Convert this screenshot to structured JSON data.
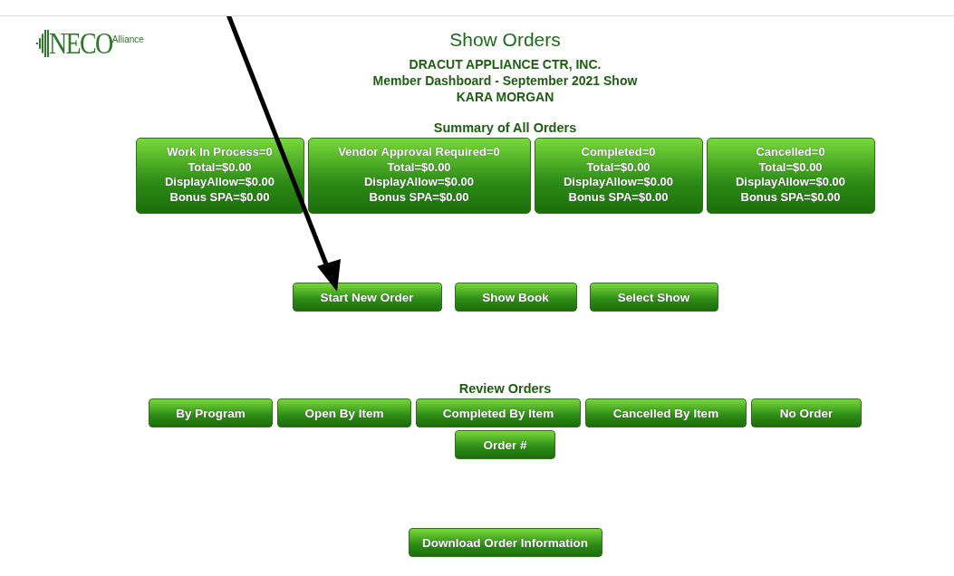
{
  "logo": {
    "wordmark": "NECO",
    "suffix": "Alliance"
  },
  "page_title": "Show Orders",
  "header_lines": [
    "DRACUT APPLIANCE CTR, INC.",
    "Member Dashboard - September 2021 Show",
    "KARA MORGAN"
  ],
  "summary": {
    "title": "Summary of All Orders",
    "cards": [
      {
        "lines": [
          "Work In Process=0",
          "Total=$0.00",
          "DisplayAllow=$0.00",
          "Bonus SPA=$0.00"
        ]
      },
      {
        "lines": [
          "Vendor Approval Required=0",
          "Total=$0.00",
          "DisplayAllow=$0.00",
          "Bonus SPA=$0.00"
        ]
      },
      {
        "lines": [
          "Completed=0",
          "Total=$0.00",
          "DisplayAllow=$0.00",
          "Bonus SPA=$0.00"
        ]
      },
      {
        "lines": [
          "Cancelled=0",
          "Total=$0.00",
          "DisplayAllow=$0.00",
          "Bonus SPA=$0.00"
        ]
      }
    ]
  },
  "actions": [
    "Start New Order",
    "Show Book",
    "Select Show"
  ],
  "review": {
    "title": "Review Orders",
    "buttons": [
      "By Program",
      "Open By Item",
      "Completed By Item",
      "Cancelled By Item",
      "No Order"
    ],
    "second_row": [
      "Order #"
    ]
  },
  "download_button": "Download Order Information",
  "annotation": {
    "kind": "arrow"
  }
}
